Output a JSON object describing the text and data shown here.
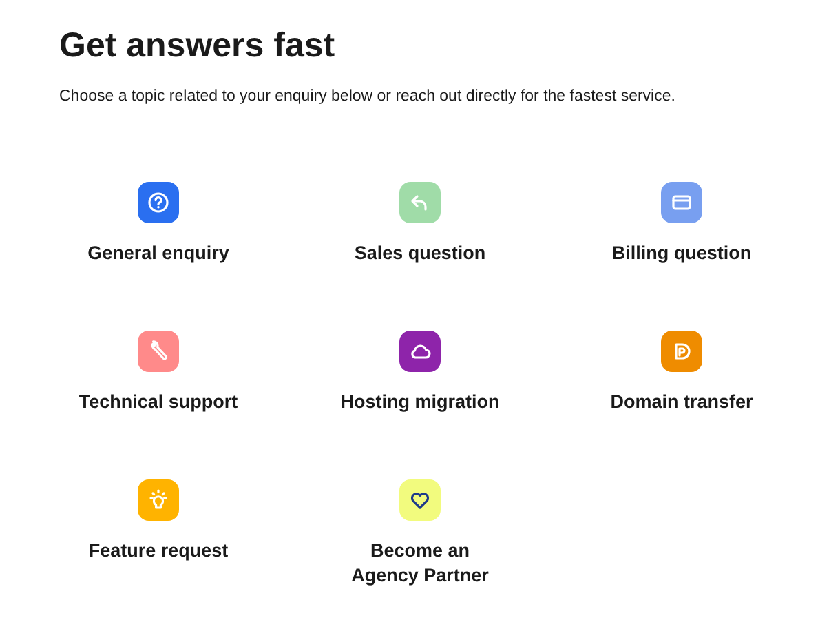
{
  "heading": "Get answers fast",
  "intro": "Choose a topic related to your enquiry below or reach out directly for the fastest service.",
  "topics": [
    {
      "label": "General enquiry",
      "color": "#2a6ff0"
    },
    {
      "label": "Sales question",
      "color": "#a0dca8"
    },
    {
      "label": "Billing question",
      "color": "#789ff0"
    },
    {
      "label": "Technical support",
      "color": "#ff8a8a"
    },
    {
      "label": "Hosting migration",
      "color": "#8e24aa"
    },
    {
      "label": "Domain transfer",
      "color": "#ef8c00"
    },
    {
      "label": "Feature request",
      "color": "#ffb300"
    },
    {
      "label": "Become an Agency Partner",
      "color": "#f2fb7e"
    }
  ]
}
